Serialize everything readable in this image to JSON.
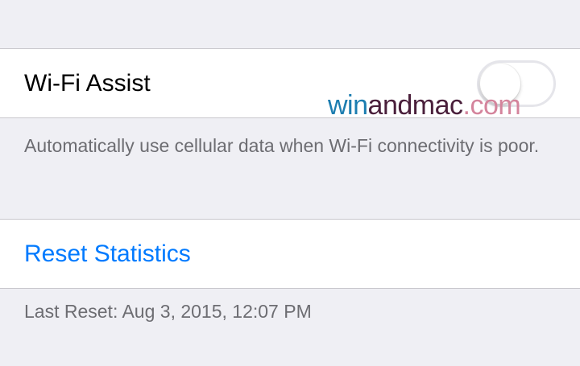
{
  "wifi_assist": {
    "label": "Wi-Fi Assist",
    "toggle_state": "off",
    "footer": "Automatically use cellular data when Wi-Fi connectivity is poor."
  },
  "reset": {
    "label": "Reset Statistics",
    "last_reset": "Last Reset: Aug 3, 2015, 12:07 PM"
  },
  "watermark": {
    "part1": "win",
    "part2": "andmac",
    "part3": ".com"
  },
  "colors": {
    "background": "#efeff4",
    "link": "#007aff",
    "footer_text": "#6d6d72",
    "separator": "#c8c7cc"
  }
}
